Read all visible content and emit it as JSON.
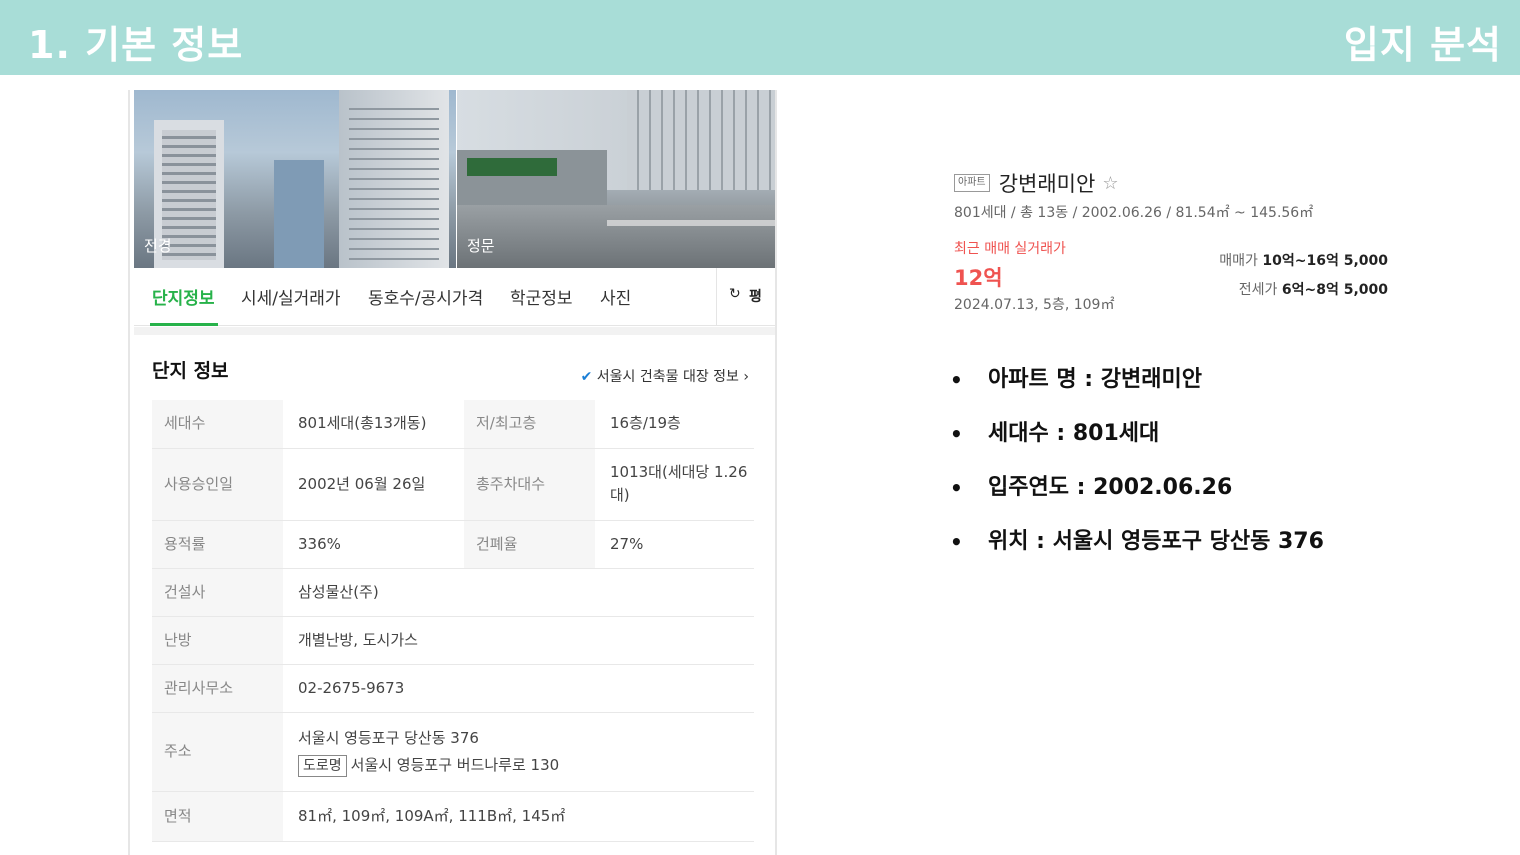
{
  "header": {
    "title": "1. 기본 정보",
    "right_title": "입지 분석"
  },
  "photos": [
    {
      "caption": "전경"
    },
    {
      "caption": "정문"
    }
  ],
  "tabs": [
    {
      "label": "단지정보",
      "active": true
    },
    {
      "label": "시세/실거래가"
    },
    {
      "label": "동호수/공시가격"
    },
    {
      "label": "학군정보"
    },
    {
      "label": "사진"
    }
  ],
  "unit_toggle": {
    "icon": "↻",
    "label": "평"
  },
  "complex": {
    "title": "단지 정보",
    "link_label": "서울시 건축물 대장 정보",
    "rows": {
      "households_label": "세대수",
      "households": "801세대(총13개동)",
      "floors_label": "저/최고층",
      "floors": "16층/19층",
      "approval_label": "사용승인일",
      "approval": "2002년 06월 26일",
      "parking_label": "총주차대수",
      "parking": "1013대(세대당 1.26대)",
      "far_label": "용적률",
      "far": "336%",
      "bcr_label": "건폐율",
      "bcr": "27%",
      "builder_label": "건설사",
      "builder": "삼성물산(주)",
      "heating_label": "난방",
      "heating": "개별난방, 도시가스",
      "office_label": "관리사무소",
      "office": "02-2675-9673",
      "address_label": "주소",
      "address": "서울시 영등포구 당산동 376",
      "road_badge": "도로명",
      "road_address": "서울시 영등포구 버드나루로 130",
      "area_label": "면적",
      "area": "81㎡, 109㎡, 109A㎡, 111B㎡, 145㎡"
    }
  },
  "summary": {
    "type_badge": "아파트",
    "name": "강변래미안",
    "meta": "801세대 / 총 13동 / 2002.06.26 / 81.54㎡ ~ 145.56㎡",
    "recent_label": "최근 매매 실거래가",
    "recent_price": "12억",
    "recent_detail": "2024.07.13, 5층, 109㎡",
    "sale_label": "매매가",
    "sale_range": "10억~16억 5,000",
    "jeonse_label": "전세가",
    "jeonse_range": "6억~8억 5,000"
  },
  "bullets": [
    "아파트 명 : 강변래미안",
    "세대수 : 801세대",
    "입주연도 : 2002.06.26",
    "위치 : 서울시 영등포구 당산동 376"
  ],
  "colors": {
    "header_bg": "#a8ddd7",
    "accent_green": "#27b24a",
    "price_red": "#ef5350"
  }
}
